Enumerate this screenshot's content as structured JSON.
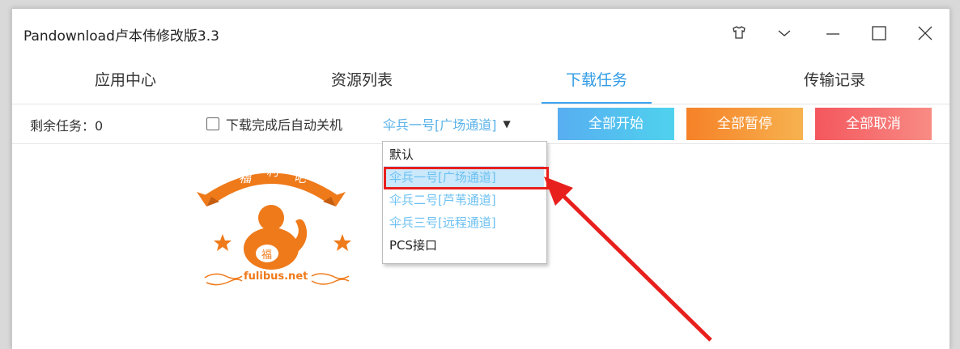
{
  "window": {
    "title": "Pandownload卢本伟修改版3.3",
    "controls": [
      "skin-icon",
      "chevron-down-icon",
      "minimize-icon",
      "maximize-icon",
      "close-icon"
    ]
  },
  "tabs": [
    {
      "label": "应用中心",
      "active": false
    },
    {
      "label": "资源列表",
      "active": false
    },
    {
      "label": "下载任务",
      "active": true
    },
    {
      "label": "传输记录",
      "active": false
    }
  ],
  "toolbar": {
    "remaining_tasks": "剩余任务：0",
    "auto_shutdown_label": "下载完成后自动关机",
    "auto_shutdown_checked": false,
    "channel_selected": "伞兵一号[广场通道]",
    "start_all": "全部开始",
    "pause_all": "全部暂停",
    "cancel_all": "全部取消"
  },
  "dropdown": {
    "options": [
      {
        "label": "默认",
        "highlighted": false
      },
      {
        "label": "伞兵一号[广场通道]",
        "highlighted": true
      },
      {
        "label": "伞兵二号[芦苇通道]",
        "highlighted": false
      },
      {
        "label": "伞兵三号[远程通道]",
        "highlighted": false
      },
      {
        "label": "PCS接口",
        "highlighted": false
      }
    ]
  },
  "watermark": {
    "banner": "福 利 吧",
    "badge": "福",
    "site": "fulibus.net"
  },
  "colors": {
    "accent_blue": "#3ea2ec",
    "annotation_red": "#e8201d",
    "logo_orange": "#ef7a1a"
  }
}
